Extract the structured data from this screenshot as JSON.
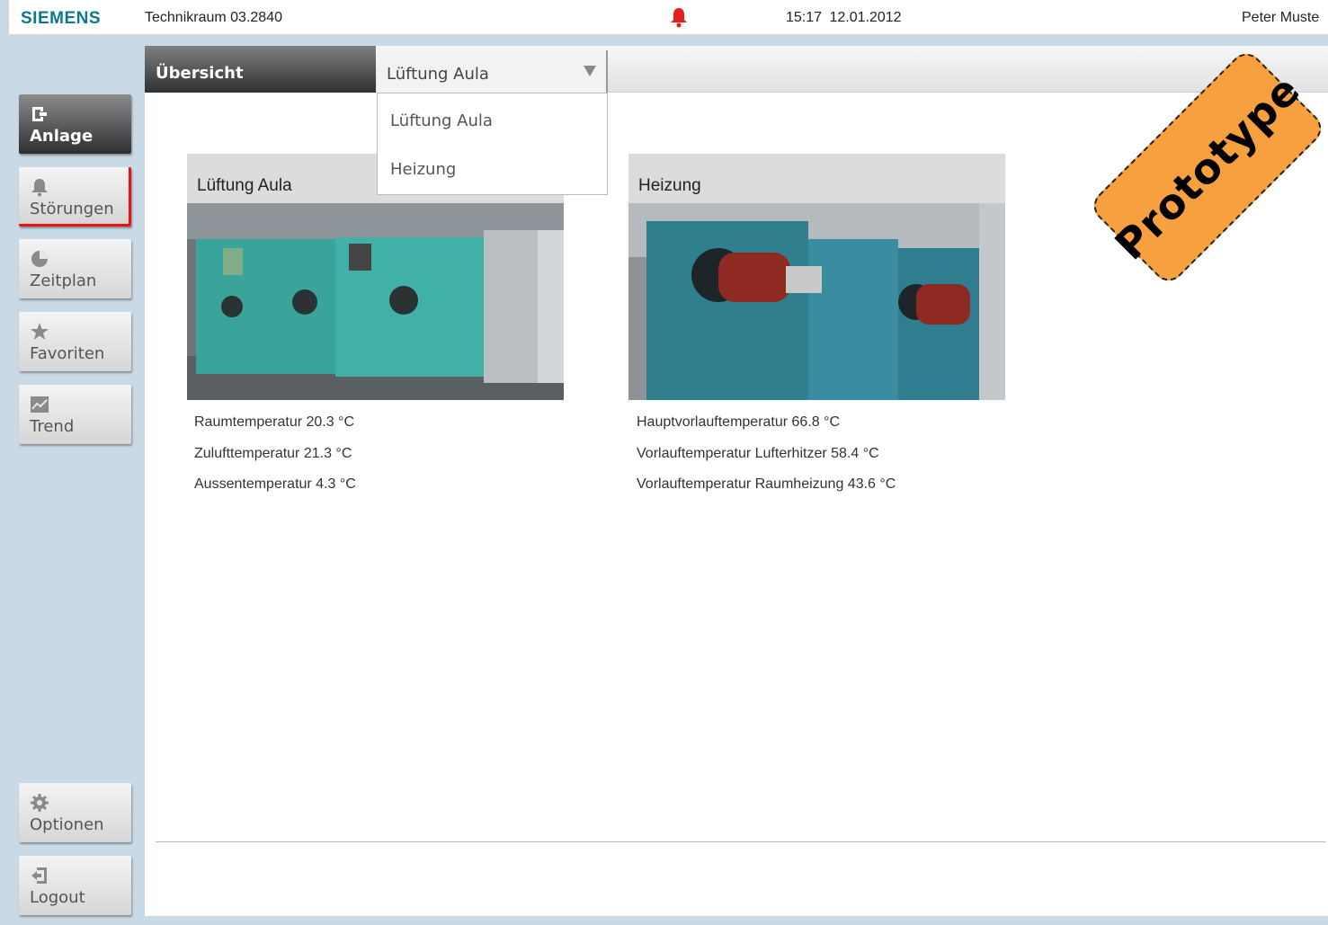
{
  "header": {
    "brand": "SIEMENS",
    "location": "Technikraum 03.2840",
    "time": "15:17",
    "date": "12.01.2012",
    "user": "Peter Muste",
    "alarm_color": "#e5201c"
  },
  "nav": {
    "anlage": "Anlage",
    "stoerungen": "Störungen",
    "zeitplan": "Zeitplan",
    "favoriten": "Favoriten",
    "trend": "Trend",
    "optionen": "Optionen",
    "logout": "Logout"
  },
  "tabs": {
    "overview": "Übersicht",
    "selected": "Lüftung Aula",
    "options": [
      "Lüftung Aula",
      "Heizung"
    ]
  },
  "cards": [
    {
      "title": "Lüftung Aula",
      "readings": [
        "Raumtemperatur 20.3 °C",
        "Zulufttemperatur 21.3 °C",
        "Aussentemperatur 4.3 °C"
      ]
    },
    {
      "title": "Heizung",
      "readings": [
        "Hauptvorlauftemperatur 66.8 °C",
        "Vorlauftemperatur Lufterhitzer 58.4 °C",
        "Vorlauftemperatur Raumheizung 43.6 °C"
      ]
    }
  ],
  "stamp": "Prototype",
  "colors": {
    "brand": "#0a7a8a",
    "background": "#c9d9e6",
    "stamp": "#f7a040"
  }
}
